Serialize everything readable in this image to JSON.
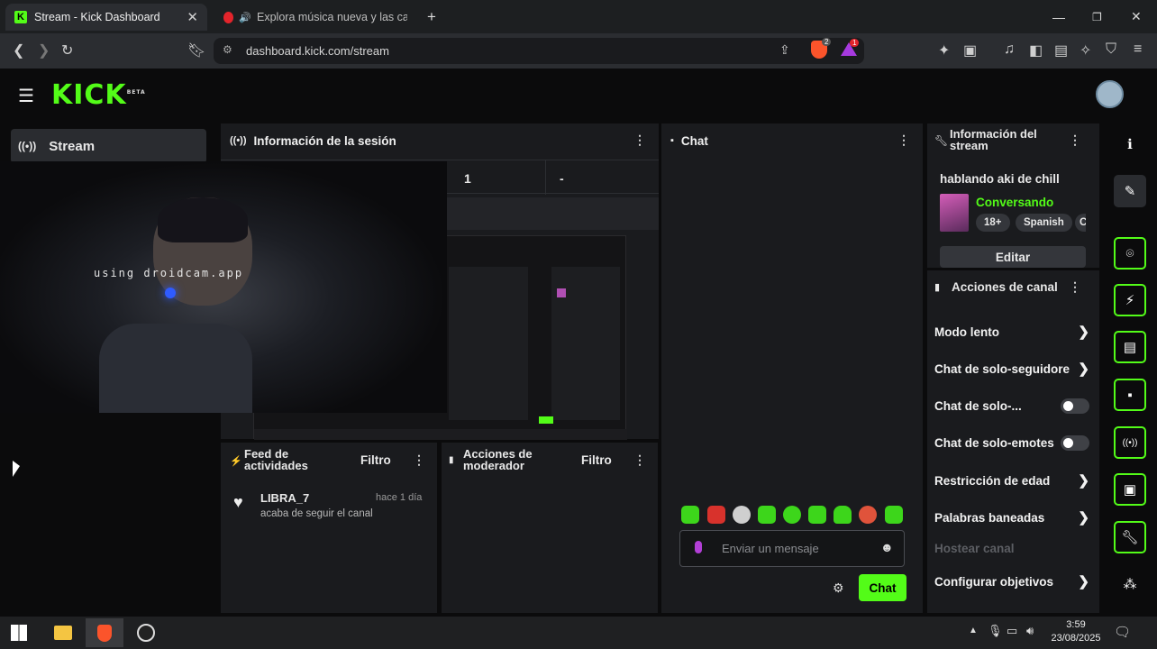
{
  "browser": {
    "tabs": [
      {
        "title": "Stream - Kick Dashboard",
        "active": true
      },
      {
        "title": "Explora música nueva y las cancio"
      }
    ],
    "new_tab_label": "+",
    "url": "dashboard.kick.com/stream",
    "badges": {
      "brave": "2",
      "rewards": "1"
    }
  },
  "header": {
    "logo": "KICK",
    "logo_tag": "BETA"
  },
  "sidebar": {
    "active_item": "Stream"
  },
  "overlay": {
    "watermark": "using droidcam.app"
  },
  "session_panel": {
    "title": "Información de la sesión",
    "stats": [
      "1",
      "-"
    ]
  },
  "chat_panel": {
    "title": "Chat",
    "input_placeholder": "Enviar un mensaje",
    "send_label": "Chat"
  },
  "stream_info": {
    "title": "Información del stream",
    "stream_title": "hablando aki de chill",
    "category": "Conversando",
    "tags": [
      "18+",
      "Spanish",
      "C"
    ],
    "edit_label": "Editar"
  },
  "channel_actions": {
    "title": "Acciones de canal",
    "items": [
      {
        "label": "Modo lento",
        "control": "chevron"
      },
      {
        "label": "Chat de solo-seguidores",
        "control": "chevron"
      },
      {
        "label": "Chat de solo-...",
        "control": "toggle"
      },
      {
        "label": "Chat de solo-emotes",
        "control": "toggle"
      },
      {
        "label": "Restricción de edad",
        "control": "chevron"
      },
      {
        "label": "Palabras baneadas",
        "control": "chevron"
      },
      {
        "label": "Hostear canal",
        "control": "disabled"
      },
      {
        "label": "Configurar objetivos",
        "control": "chevron"
      }
    ]
  },
  "activity_feed": {
    "title": "Feed de actividades",
    "filter_label": "Filtro",
    "events": [
      {
        "user": "LIBRA_7",
        "time": "hace 1 día",
        "text": "acaba de seguir el canal"
      }
    ]
  },
  "mod_actions": {
    "title": "Acciones de moderador",
    "filter_label": "Filtro"
  },
  "taskbar": {
    "time": "3:59",
    "date": "23/08/2025"
  },
  "colors": {
    "accent": "#53fc18",
    "panel": "#1a1b1e",
    "background": "#0b0b0c"
  }
}
